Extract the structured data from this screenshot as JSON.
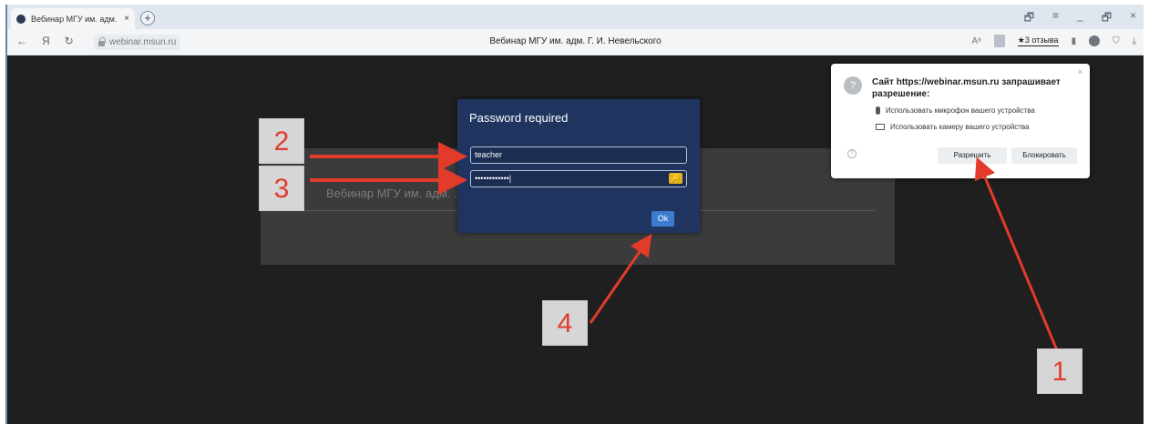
{
  "browser": {
    "tab_title": "Вебинар МГУ им. адм.",
    "tab_close": "×",
    "new_tab": "+",
    "url": "webinar.msun.ru",
    "page_title": "Вебинар МГУ им. адм. Г. И. Невельского",
    "reviews_label": "★3 отзыва",
    "window_controls": [
      "🗗",
      "≡",
      "_",
      "🗗",
      "×"
    ],
    "nav": {
      "back": "←",
      "yandex": "Я",
      "reload": "↻"
    }
  },
  "page": {
    "login_text": "Вебинар МГУ им. адм. … crophone and camera."
  },
  "dialog": {
    "title": "Password required",
    "username_value": "teacher",
    "password_value": "••••••••••••|",
    "ok_label": "Ok"
  },
  "permission_popup": {
    "heading": "Сайт https://webinar.msun.ru запрашивает разрешение:",
    "mic_text": "Использовать микрофон вашего устройства",
    "camera_text": "Использовать камеру вашего устройства",
    "allow_label": "Разрешить",
    "block_label": "Блокировать",
    "close": "×"
  },
  "callouts": [
    "1",
    "2",
    "3",
    "4"
  ],
  "colors": {
    "annotation_red": "#e23b2c",
    "dialog_bg": "#1f3560",
    "ok_blue": "#3d7bd0"
  }
}
